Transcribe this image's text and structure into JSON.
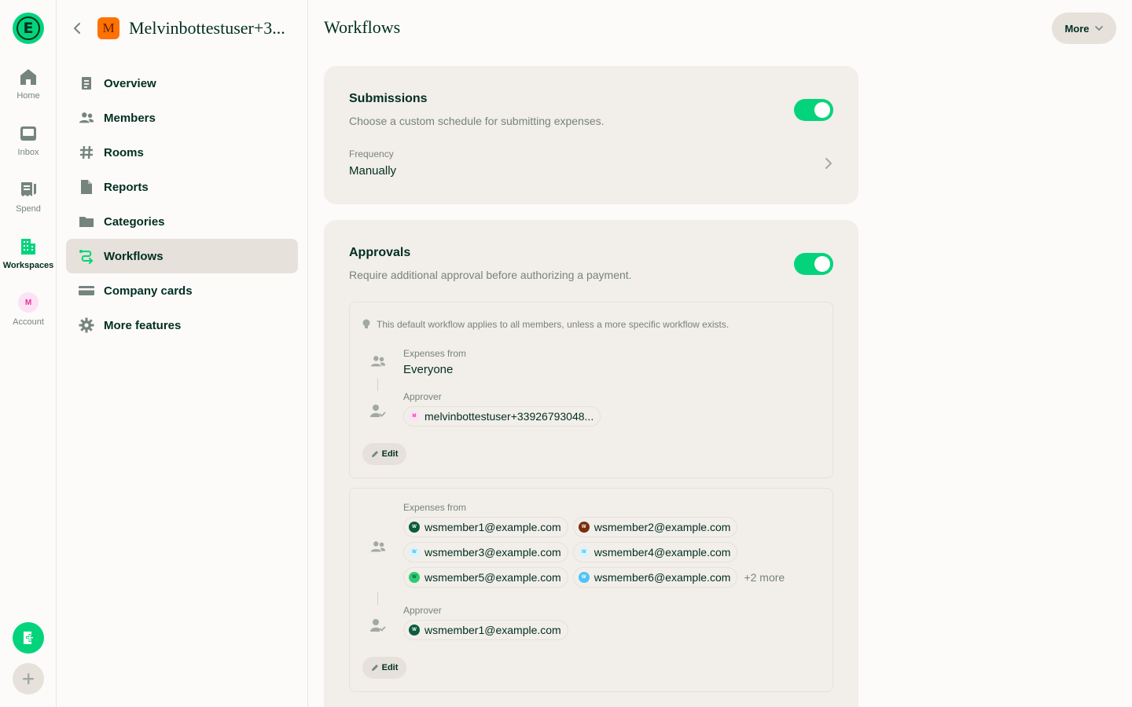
{
  "rail": {
    "logo_letter": "E",
    "items": [
      {
        "label": "Home",
        "icon": "home-icon"
      },
      {
        "label": "Inbox",
        "icon": "inbox-icon"
      },
      {
        "label": "Spend",
        "icon": "receipt-icon"
      },
      {
        "label": "Workspaces",
        "icon": "building-icon"
      },
      {
        "label": "Account",
        "icon": "avatar"
      }
    ],
    "account_initial": "M"
  },
  "workspace": {
    "avatar_letter": "M",
    "name": "Melvinbottestuser+3..."
  },
  "nav": {
    "items": [
      {
        "label": "Overview",
        "icon": "document-icon"
      },
      {
        "label": "Members",
        "icon": "users-icon"
      },
      {
        "label": "Rooms",
        "icon": "hashtag-icon"
      },
      {
        "label": "Reports",
        "icon": "file-icon"
      },
      {
        "label": "Categories",
        "icon": "folder-icon"
      },
      {
        "label": "Workflows",
        "icon": "workflow-icon"
      },
      {
        "label": "Company cards",
        "icon": "card-icon"
      },
      {
        "label": "More features",
        "icon": "gear-icon"
      }
    ],
    "active_index": 5
  },
  "header": {
    "title": "Workflows",
    "more_label": "More"
  },
  "submissions": {
    "title": "Submissions",
    "description": "Choose a custom schedule for submitting expenses.",
    "enabled": true,
    "frequency_label": "Frequency",
    "frequency_value": "Manually"
  },
  "approvals": {
    "title": "Approvals",
    "description": "Require additional approval before authorizing a payment.",
    "enabled": true,
    "default_workflow": {
      "hint": "This default workflow applies to all members, unless a more specific workflow exists.",
      "expenses_from_label": "Expenses from",
      "expenses_from_value": "Everyone",
      "approver_label": "Approver",
      "approver": "melvinbottestuser+33926793048...",
      "edit_label": "Edit"
    },
    "custom_workflow": {
      "expenses_from_label": "Expenses from",
      "members": [
        {
          "email": "wsmember1@example.com",
          "color": "#0b5c3e",
          "text_color": "#ffffff"
        },
        {
          "email": "wsmember2@example.com",
          "color": "#7a2e0b",
          "text_color": "#ffffff"
        },
        {
          "email": "wsmember3@example.com",
          "color": "#d9f4fc",
          "text_color": "#3cb7e0"
        },
        {
          "email": "wsmember4@example.com",
          "color": "#d9f4fc",
          "text_color": "#3cb7e0"
        },
        {
          "email": "wsmember5@example.com",
          "color": "#2ecc71",
          "text_color": "#0b5c3e"
        },
        {
          "email": "wsmember6@example.com",
          "color": "#4fc3f7",
          "text_color": "#ffffff"
        }
      ],
      "more": "+2 more",
      "approver_label": "Approver",
      "approver": "wsmember1@example.com",
      "approver_color": "#0b5c3e",
      "edit_label": "Edit"
    }
  },
  "colors": {
    "accent": "#03d47c",
    "text": "#002e22",
    "muted": "#76847e",
    "card": "#f2eee9",
    "active_nav": "#e6e1da"
  }
}
